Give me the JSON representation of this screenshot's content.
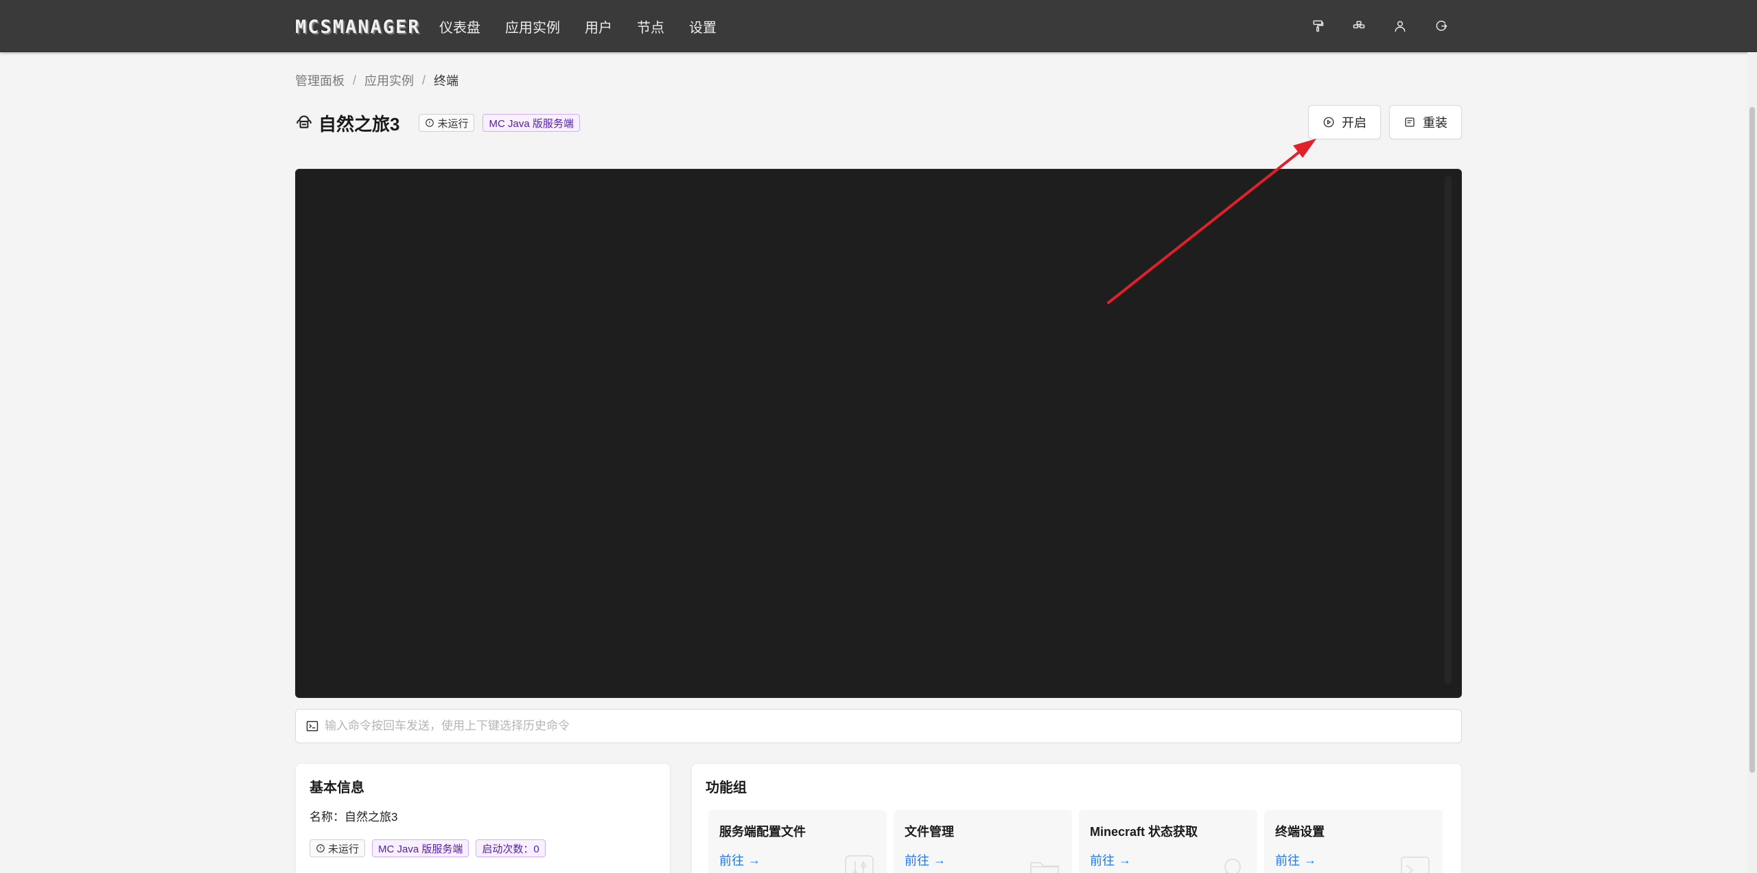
{
  "app": {
    "logo_text": "MCSMANAGER"
  },
  "nav": {
    "items": [
      {
        "label": "仪表盘"
      },
      {
        "label": "应用实例"
      },
      {
        "label": "用户"
      },
      {
        "label": "节点"
      },
      {
        "label": "设置"
      }
    ],
    "right_icons": [
      "paint-roller-icon",
      "nodes-icon",
      "user-icon",
      "logout-icon"
    ]
  },
  "breadcrumb": {
    "items": [
      "管理面板",
      "应用实例",
      "终端"
    ],
    "separator": "/"
  },
  "instance": {
    "title": "自然之旅3",
    "status": "未运行",
    "type": "MC Java 版服务端"
  },
  "actions": {
    "start_label": "开启",
    "reinstall_label": "重装"
  },
  "terminal": {
    "background": "#1e1e1e",
    "command_placeholder": "输入命令按回车发送，使用上下键选择历史命令"
  },
  "basic_info": {
    "title": "基本信息",
    "name_line": "名称：自然之旅3",
    "status": "未运行",
    "type": "MC Java 版服务端",
    "start_count": "启动次数：0"
  },
  "functions": {
    "title": "功能组",
    "link_label": "前往",
    "items": [
      {
        "name": "服务端配置文件",
        "icon": "sliders-icon"
      },
      {
        "name": "文件管理",
        "icon": "folder-icon"
      },
      {
        "name": "Minecraft 状态获取",
        "icon": "search-icon"
      },
      {
        "name": "终端设置",
        "icon": "terminal-icon"
      }
    ]
  },
  "colors": {
    "topbar": "#3a3a3a",
    "link": "#1677ff",
    "tag_type_text": "#531dab",
    "annotation_arrow": "#e0202a"
  }
}
